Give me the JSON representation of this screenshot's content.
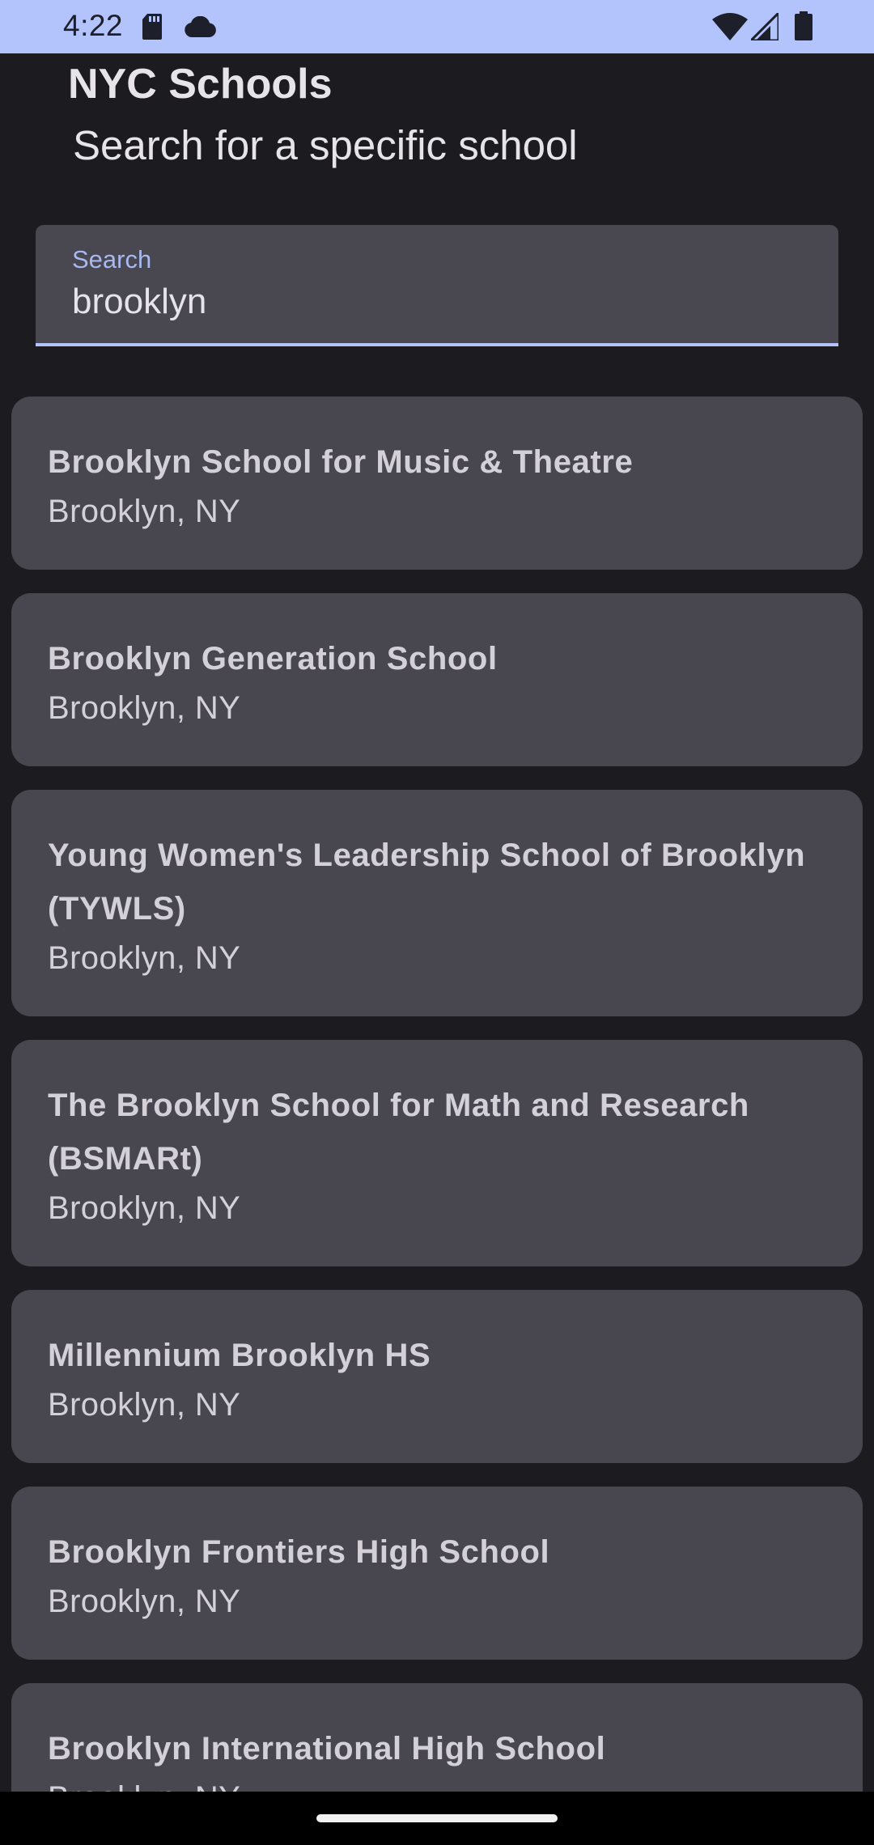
{
  "status_bar": {
    "time": "4:22",
    "left_icons": [
      "sd-card-icon",
      "cloud-icon"
    ],
    "right_icons": [
      "wifi-icon",
      "cellular-signal-icon",
      "battery-icon"
    ],
    "background_color": "#b3c3fb"
  },
  "header": {
    "title": "NYC Schools",
    "subtitle": "Search for a specific school"
  },
  "search": {
    "label": "Search",
    "value": "brooklyn",
    "accent_color": "#b3c3fb"
  },
  "results": [
    {
      "name": "Brooklyn School for Music & Theatre",
      "location": "Brooklyn, NY"
    },
    {
      "name": "Brooklyn Generation School",
      "location": "Brooklyn, NY"
    },
    {
      "name": "Young Women's Leadership School of Brooklyn (TYWLS)",
      "location": "Brooklyn, NY"
    },
    {
      "name": "The Brooklyn School for Math and Research (BSMARt)",
      "location": "Brooklyn, NY"
    },
    {
      "name": "Millennium Brooklyn HS",
      "location": "Brooklyn, NY"
    },
    {
      "name": "Brooklyn Frontiers High School",
      "location": "Brooklyn, NY"
    },
    {
      "name": "Brooklyn International High School",
      "location": "Brooklyn, NY"
    }
  ],
  "colors": {
    "background": "#1c1b20",
    "card": "#48474f",
    "text": "#d3d0d8"
  }
}
